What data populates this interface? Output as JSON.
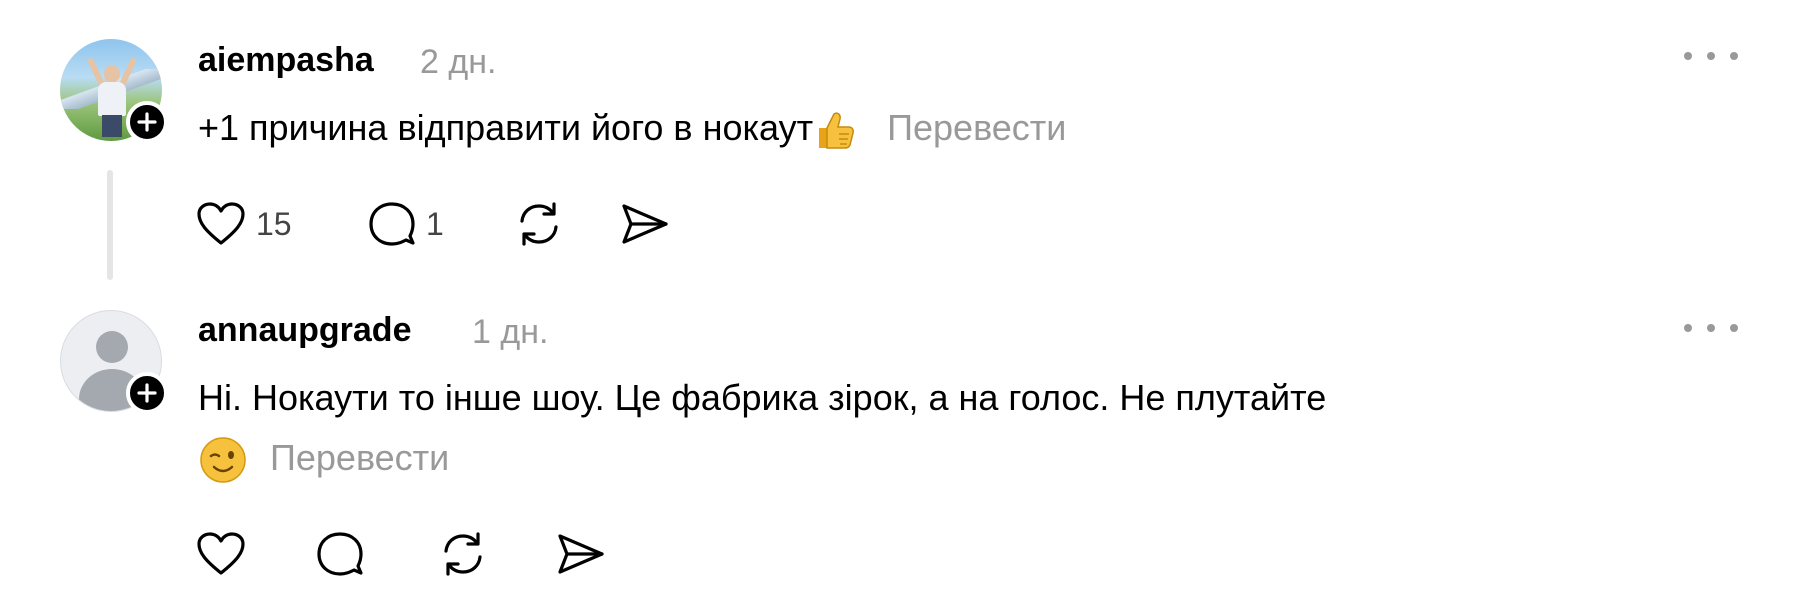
{
  "comments": [
    {
      "username": "aiempasha",
      "time": "2 дн.",
      "text": "+1 причина відправити його в нокаут",
      "translate_label": "Перевести",
      "likes": "15",
      "replies": "1"
    },
    {
      "username": "annaupgrade",
      "time": "1 дн.",
      "text": "Ні. Нокаути то інше шоу. Це фабрика зірок, а на голос. Не плутайте",
      "translate_label": "Перевести"
    }
  ],
  "colors": {
    "text": "#000000",
    "muted": "#999999",
    "thread_line": "#e5e5e5",
    "badge": "#000000"
  },
  "icons": [
    "plus-icon",
    "more-icon",
    "heart-icon",
    "comment-icon",
    "repost-icon",
    "share-icon",
    "thumbs-up-emoji",
    "wink-emoji"
  ]
}
